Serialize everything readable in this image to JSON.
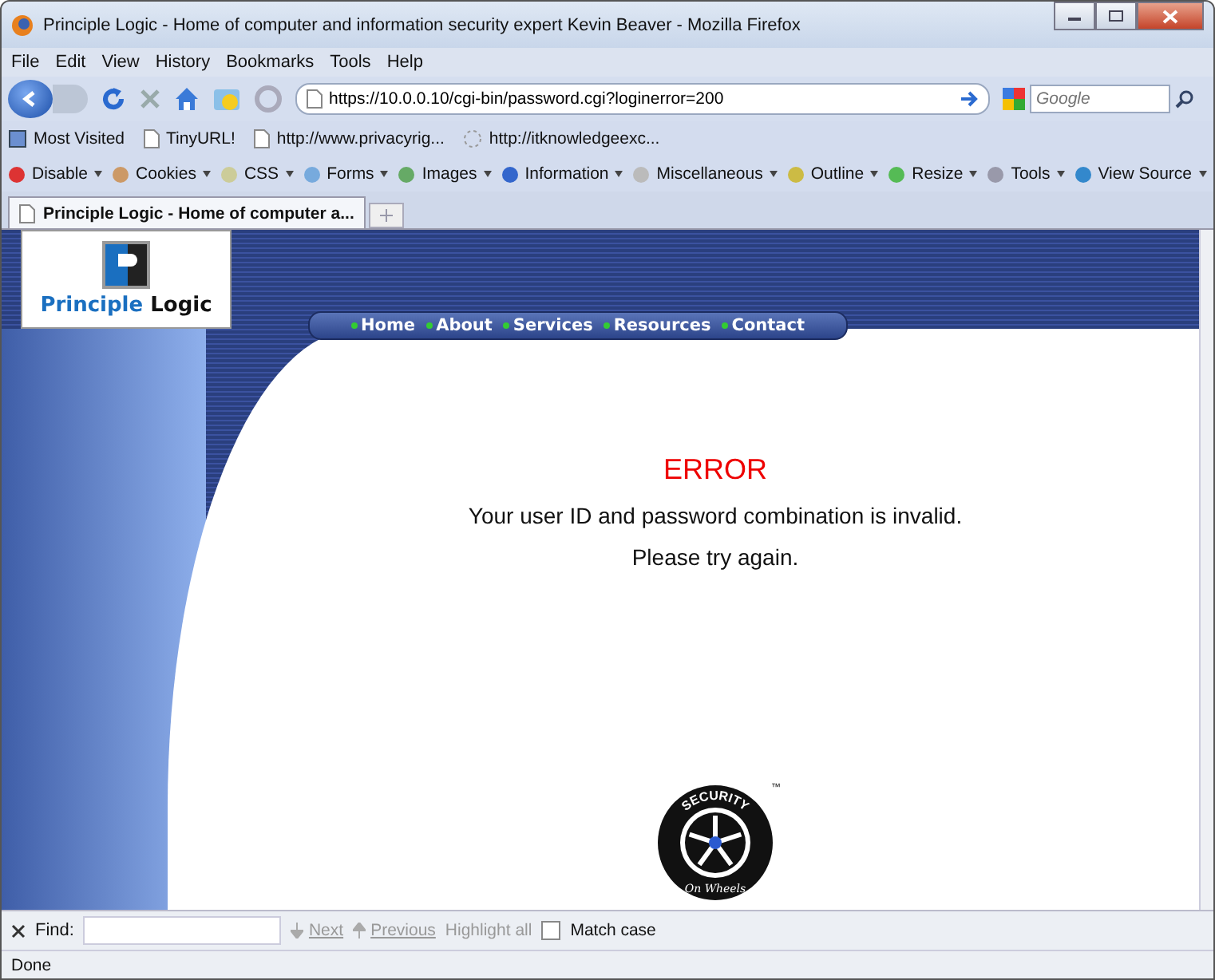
{
  "window": {
    "title": "Principle Logic - Home of computer and information security expert Kevin Beaver - Mozilla Firefox"
  },
  "menu": [
    "File",
    "Edit",
    "View",
    "History",
    "Bookmarks",
    "Tools",
    "Help"
  ],
  "address": {
    "value": "https://10.0.0.10/cgi-bin/password.cgi?loginerror=200"
  },
  "search": {
    "placeholder": "Google"
  },
  "bookmarks": [
    {
      "label": "Most Visited",
      "kind": "folder"
    },
    {
      "label": "TinyURL!",
      "kind": "page"
    },
    {
      "label": "http://www.privacyrig...",
      "kind": "page"
    },
    {
      "label": "http://itknowledgeexc...",
      "kind": "loading"
    }
  ],
  "webdev_toolbar": [
    {
      "label": "Disable",
      "kind": "disable"
    },
    {
      "label": "Cookies",
      "kind": "cookies"
    },
    {
      "label": "CSS",
      "kind": "css"
    },
    {
      "label": "Forms",
      "kind": "forms"
    },
    {
      "label": "Images",
      "kind": "images"
    },
    {
      "label": "Information",
      "kind": "info"
    },
    {
      "label": "Miscellaneous",
      "kind": "misc"
    },
    {
      "label": "Outline",
      "kind": "outline"
    },
    {
      "label": "Resize",
      "kind": "resize"
    },
    {
      "label": "Tools",
      "kind": "tools"
    },
    {
      "label": "View Source",
      "kind": "source"
    }
  ],
  "tabs": [
    {
      "label": "Principle Logic - Home of computer a...",
      "selected": true
    }
  ],
  "page": {
    "logo": {
      "first": "Principle",
      "second": "Logic"
    },
    "nav": [
      "Home",
      "About",
      "Services",
      "Resources",
      "Contact"
    ],
    "error_title": "ERROR",
    "messages": [
      "Your user ID and password combination is invalid.",
      "Please try again."
    ],
    "badge": {
      "top": "SECURITY",
      "bottom": "On Wheels",
      "mark": "™"
    }
  },
  "find_bar": {
    "label": "Find:",
    "next": "Next",
    "previous": "Previous",
    "highlight": "Highlight all",
    "match_case": {
      "label": "Match case",
      "checked": false
    }
  },
  "status_bar": "Done"
}
